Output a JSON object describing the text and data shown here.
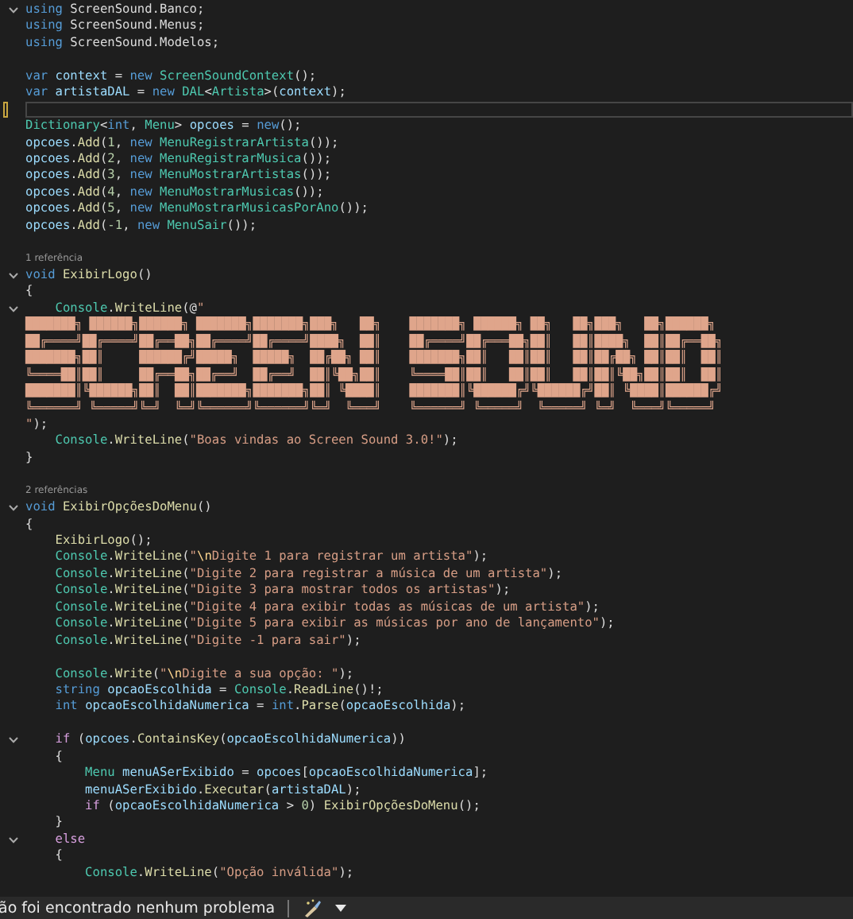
{
  "editor": {
    "lines": [
      {
        "kind": "code",
        "fold": true,
        "tokens": [
          {
            "kind": "keyword",
            "text": "using "
          },
          {
            "kind": "plain",
            "text": "ScreenSound.Banco;"
          }
        ]
      },
      {
        "kind": "code",
        "tokens": [
          {
            "kind": "keyword",
            "text": "using "
          },
          {
            "kind": "plain",
            "text": "ScreenSound.Menus;"
          }
        ]
      },
      {
        "kind": "code",
        "tokens": [
          {
            "kind": "keyword",
            "text": "using "
          },
          {
            "kind": "plain",
            "text": "ScreenSound.Modelos;"
          }
        ]
      },
      {
        "kind": "blank"
      },
      {
        "kind": "code",
        "tokens": [
          {
            "kind": "keyword",
            "text": "var "
          },
          {
            "kind": "variable",
            "text": "context"
          },
          {
            "kind": "plain",
            "text": " = "
          },
          {
            "kind": "keyword",
            "text": "new "
          },
          {
            "kind": "type",
            "text": "ScreenSoundContext"
          },
          {
            "kind": "plain",
            "text": "();"
          }
        ]
      },
      {
        "kind": "code",
        "tokens": [
          {
            "kind": "keyword",
            "text": "var "
          },
          {
            "kind": "variable",
            "text": "artistaDAL"
          },
          {
            "kind": "plain",
            "text": " = "
          },
          {
            "kind": "keyword",
            "text": "new "
          },
          {
            "kind": "type",
            "text": "DAL"
          },
          {
            "kind": "plain",
            "text": "<"
          },
          {
            "kind": "type",
            "text": "Artista"
          },
          {
            "kind": "plain",
            "text": ">("
          },
          {
            "kind": "variable",
            "text": "context"
          },
          {
            "kind": "plain",
            "text": ");"
          }
        ]
      },
      {
        "kind": "blank",
        "current": true
      },
      {
        "kind": "code",
        "tokens": [
          {
            "kind": "type",
            "text": "Dictionary"
          },
          {
            "kind": "plain",
            "text": "<"
          },
          {
            "kind": "keyword",
            "text": "int"
          },
          {
            "kind": "plain",
            "text": ", "
          },
          {
            "kind": "type",
            "text": "Menu"
          },
          {
            "kind": "plain",
            "text": "> "
          },
          {
            "kind": "variable",
            "text": "opcoes"
          },
          {
            "kind": "plain",
            "text": " = "
          },
          {
            "kind": "keyword",
            "text": "new"
          },
          {
            "kind": "plain",
            "text": "();"
          }
        ]
      },
      {
        "kind": "code",
        "tokens": [
          {
            "kind": "variable",
            "text": "opcoes"
          },
          {
            "kind": "plain",
            "text": "."
          },
          {
            "kind": "method",
            "text": "Add"
          },
          {
            "kind": "plain",
            "text": "("
          },
          {
            "kind": "number",
            "text": "1"
          },
          {
            "kind": "plain",
            "text": ", "
          },
          {
            "kind": "keyword",
            "text": "new "
          },
          {
            "kind": "type",
            "text": "MenuRegistrarArtista"
          },
          {
            "kind": "plain",
            "text": "());"
          }
        ]
      },
      {
        "kind": "code",
        "tokens": [
          {
            "kind": "variable",
            "text": "opcoes"
          },
          {
            "kind": "plain",
            "text": "."
          },
          {
            "kind": "method",
            "text": "Add"
          },
          {
            "kind": "plain",
            "text": "("
          },
          {
            "kind": "number",
            "text": "2"
          },
          {
            "kind": "plain",
            "text": ", "
          },
          {
            "kind": "keyword",
            "text": "new "
          },
          {
            "kind": "type",
            "text": "MenuRegistrarMusica"
          },
          {
            "kind": "plain",
            "text": "());"
          }
        ]
      },
      {
        "kind": "code",
        "tokens": [
          {
            "kind": "variable",
            "text": "opcoes"
          },
          {
            "kind": "plain",
            "text": "."
          },
          {
            "kind": "method",
            "text": "Add"
          },
          {
            "kind": "plain",
            "text": "("
          },
          {
            "kind": "number",
            "text": "3"
          },
          {
            "kind": "plain",
            "text": ", "
          },
          {
            "kind": "keyword",
            "text": "new "
          },
          {
            "kind": "type",
            "text": "MenuMostrarArtistas"
          },
          {
            "kind": "plain",
            "text": "());"
          }
        ]
      },
      {
        "kind": "code",
        "tokens": [
          {
            "kind": "variable",
            "text": "opcoes"
          },
          {
            "kind": "plain",
            "text": "."
          },
          {
            "kind": "method",
            "text": "Add"
          },
          {
            "kind": "plain",
            "text": "("
          },
          {
            "kind": "number",
            "text": "4"
          },
          {
            "kind": "plain",
            "text": ", "
          },
          {
            "kind": "keyword",
            "text": "new "
          },
          {
            "kind": "type",
            "text": "MenuMostrarMusicas"
          },
          {
            "kind": "plain",
            "text": "());"
          }
        ]
      },
      {
        "kind": "code",
        "tokens": [
          {
            "kind": "variable",
            "text": "opcoes"
          },
          {
            "kind": "plain",
            "text": "."
          },
          {
            "kind": "method",
            "text": "Add"
          },
          {
            "kind": "plain",
            "text": "("
          },
          {
            "kind": "number",
            "text": "5"
          },
          {
            "kind": "plain",
            "text": ", "
          },
          {
            "kind": "keyword",
            "text": "new "
          },
          {
            "kind": "type",
            "text": "MenuMostrarMusicasPorAno"
          },
          {
            "kind": "plain",
            "text": "());"
          }
        ]
      },
      {
        "kind": "code",
        "tokens": [
          {
            "kind": "variable",
            "text": "opcoes"
          },
          {
            "kind": "plain",
            "text": "."
          },
          {
            "kind": "method",
            "text": "Add"
          },
          {
            "kind": "plain",
            "text": "("
          },
          {
            "kind": "number",
            "text": "-1"
          },
          {
            "kind": "plain",
            "text": ", "
          },
          {
            "kind": "keyword",
            "text": "new "
          },
          {
            "kind": "type",
            "text": "MenuSair"
          },
          {
            "kind": "plain",
            "text": "());"
          }
        ]
      },
      {
        "kind": "blank"
      },
      {
        "kind": "codelens",
        "text": "1 referência"
      },
      {
        "kind": "code",
        "fold": true,
        "tokens": [
          {
            "kind": "keyword",
            "text": "void "
          },
          {
            "kind": "method",
            "text": "ExibirLogo"
          },
          {
            "kind": "plain",
            "text": "()"
          }
        ]
      },
      {
        "kind": "code",
        "tokens": [
          {
            "kind": "plain",
            "text": "{"
          }
        ]
      },
      {
        "kind": "code",
        "fold": true,
        "tokens": [
          {
            "kind": "type",
            "text": "    Console"
          },
          {
            "kind": "plain",
            "text": "."
          },
          {
            "kind": "method",
            "text": "WriteLine"
          },
          {
            "kind": "plain",
            "text": "(@"
          },
          {
            "kind": "string",
            "text": "\""
          }
        ]
      },
      {
        "kind": "art",
        "text": "███████╗ ██████╗██████╗ ███████╗███████╗███╗   ██╗    ███████╗ ██████╗ ██╗   ██╗███╗   ██╗██████╗"
      },
      {
        "kind": "art",
        "text": "██╔════╝██╔════╝██╔══██╗██╔════╝██╔════╝████╗  ██║    ██╔════╝██╔═══██╗██║   ██║████╗  ██║██╔══██╗"
      },
      {
        "kind": "art",
        "text": "███████╗██║     ██████╔╝█████╗  █████╗  ██╔██╗ ██║    ███████╗██║   ██║██║   ██║██╔██╗ ██║██║  ██║"
      },
      {
        "kind": "art",
        "text": "╚════██║██║     ██╔══██╗██╔══╝  ██╔══╝  ██║╚██╗██║    ╚════██║██║   ██║██║   ██║██║╚██╗██║██║  ██║"
      },
      {
        "kind": "art",
        "text": "███████║╚██████╗██║  ██║███████╗███████╗██║ ╚████║    ███████║╚██████╔╝╚██████╔╝██║ ╚████║██████╔╝"
      },
      {
        "kind": "art",
        "text": "╚══════╝ ╚═════╝╚═╝  ╚═╝╚══════╝╚══════╝╚═╝  ╚═══╝    ╚══════╝ ╚═════╝  ╚═════╝ ╚═╝  ╚═══╝╚═════╝"
      },
      {
        "kind": "code",
        "tokens": [
          {
            "kind": "string",
            "text": "\""
          },
          {
            "kind": "plain",
            "text": ");"
          }
        ]
      },
      {
        "kind": "code",
        "tokens": [
          {
            "kind": "type",
            "text": "    Console"
          },
          {
            "kind": "plain",
            "text": "."
          },
          {
            "kind": "method",
            "text": "WriteLine"
          },
          {
            "kind": "plain",
            "text": "("
          },
          {
            "kind": "string",
            "text": "\"Boas vindas ao Screen Sound 3.0!\""
          },
          {
            "kind": "plain",
            "text": ");"
          }
        ]
      },
      {
        "kind": "code",
        "tokens": [
          {
            "kind": "plain",
            "text": "}"
          }
        ]
      },
      {
        "kind": "blank"
      },
      {
        "kind": "codelens",
        "text": "2 referências"
      },
      {
        "kind": "code",
        "fold": true,
        "tokens": [
          {
            "kind": "keyword",
            "text": "void "
          },
          {
            "kind": "method",
            "text": "ExibirOpçõesDoMenu"
          },
          {
            "kind": "plain",
            "text": "()"
          }
        ]
      },
      {
        "kind": "code",
        "tokens": [
          {
            "kind": "plain",
            "text": "{"
          }
        ]
      },
      {
        "kind": "code",
        "tokens": [
          {
            "kind": "method",
            "text": "    ExibirLogo"
          },
          {
            "kind": "plain",
            "text": "();"
          }
        ]
      },
      {
        "kind": "code",
        "tokens": [
          {
            "kind": "type",
            "text": "    Console"
          },
          {
            "kind": "plain",
            "text": "."
          },
          {
            "kind": "method",
            "text": "WriteLine"
          },
          {
            "kind": "plain",
            "text": "("
          },
          {
            "kind": "string",
            "text": "\""
          },
          {
            "kind": "escape",
            "text": "\\n"
          },
          {
            "kind": "string",
            "text": "Digite 1 para registrar um artista\""
          },
          {
            "kind": "plain",
            "text": ");"
          }
        ]
      },
      {
        "kind": "code",
        "tokens": [
          {
            "kind": "type",
            "text": "    Console"
          },
          {
            "kind": "plain",
            "text": "."
          },
          {
            "kind": "method",
            "text": "WriteLine"
          },
          {
            "kind": "plain",
            "text": "("
          },
          {
            "kind": "string",
            "text": "\"Digite 2 para registrar a música de um artista\""
          },
          {
            "kind": "plain",
            "text": ");"
          }
        ]
      },
      {
        "kind": "code",
        "tokens": [
          {
            "kind": "type",
            "text": "    Console"
          },
          {
            "kind": "plain",
            "text": "."
          },
          {
            "kind": "method",
            "text": "WriteLine"
          },
          {
            "kind": "plain",
            "text": "("
          },
          {
            "kind": "string",
            "text": "\"Digite 3 para mostrar todos os artistas\""
          },
          {
            "kind": "plain",
            "text": ");"
          }
        ]
      },
      {
        "kind": "code",
        "tokens": [
          {
            "kind": "type",
            "text": "    Console"
          },
          {
            "kind": "plain",
            "text": "."
          },
          {
            "kind": "method",
            "text": "WriteLine"
          },
          {
            "kind": "plain",
            "text": "("
          },
          {
            "kind": "string",
            "text": "\"Digite 4 para exibir todas as músicas de um artista\""
          },
          {
            "kind": "plain",
            "text": ");"
          }
        ]
      },
      {
        "kind": "code",
        "tokens": [
          {
            "kind": "type",
            "text": "    Console"
          },
          {
            "kind": "plain",
            "text": "."
          },
          {
            "kind": "method",
            "text": "WriteLine"
          },
          {
            "kind": "plain",
            "text": "("
          },
          {
            "kind": "string",
            "text": "\"Digite 5 para exibir as músicas por ano de lançamento\""
          },
          {
            "kind": "plain",
            "text": ");"
          }
        ]
      },
      {
        "kind": "code",
        "tokens": [
          {
            "kind": "type",
            "text": "    Console"
          },
          {
            "kind": "plain",
            "text": "."
          },
          {
            "kind": "method",
            "text": "WriteLine"
          },
          {
            "kind": "plain",
            "text": "("
          },
          {
            "kind": "string",
            "text": "\"Digite -1 para sair\""
          },
          {
            "kind": "plain",
            "text": ");"
          }
        ]
      },
      {
        "kind": "blank"
      },
      {
        "kind": "code",
        "tokens": [
          {
            "kind": "type",
            "text": "    Console"
          },
          {
            "kind": "plain",
            "text": "."
          },
          {
            "kind": "method",
            "text": "Write"
          },
          {
            "kind": "plain",
            "text": "("
          },
          {
            "kind": "string",
            "text": "\""
          },
          {
            "kind": "escape",
            "text": "\\n"
          },
          {
            "kind": "string",
            "text": "Digite a sua opção: \""
          },
          {
            "kind": "plain",
            "text": ");"
          }
        ]
      },
      {
        "kind": "code",
        "tokens": [
          {
            "kind": "keyword",
            "text": "    string "
          },
          {
            "kind": "variable",
            "text": "opcaoEscolhida"
          },
          {
            "kind": "plain",
            "text": " = "
          },
          {
            "kind": "type",
            "text": "Console"
          },
          {
            "kind": "plain",
            "text": "."
          },
          {
            "kind": "method",
            "text": "ReadLine"
          },
          {
            "kind": "plain",
            "text": "()!;"
          }
        ]
      },
      {
        "kind": "code",
        "tokens": [
          {
            "kind": "keyword",
            "text": "    int "
          },
          {
            "kind": "variable",
            "text": "opcaoEscolhidaNumerica"
          },
          {
            "kind": "plain",
            "text": " = "
          },
          {
            "kind": "keyword",
            "text": "int"
          },
          {
            "kind": "plain",
            "text": "."
          },
          {
            "kind": "method",
            "text": "Parse"
          },
          {
            "kind": "plain",
            "text": "("
          },
          {
            "kind": "variable",
            "text": "opcaoEscolhida"
          },
          {
            "kind": "plain",
            "text": ");"
          }
        ]
      },
      {
        "kind": "blank"
      },
      {
        "kind": "code",
        "fold": true,
        "tokens": [
          {
            "kind": "control",
            "text": "    if"
          },
          {
            "kind": "plain",
            "text": " ("
          },
          {
            "kind": "variable",
            "text": "opcoes"
          },
          {
            "kind": "plain",
            "text": "."
          },
          {
            "kind": "method",
            "text": "ContainsKey"
          },
          {
            "kind": "plain",
            "text": "("
          },
          {
            "kind": "variable",
            "text": "opcaoEscolhidaNumerica"
          },
          {
            "kind": "plain",
            "text": "))"
          }
        ]
      },
      {
        "kind": "code",
        "tokens": [
          {
            "kind": "plain",
            "text": "    {"
          }
        ]
      },
      {
        "kind": "code",
        "tokens": [
          {
            "kind": "type",
            "text": "        Menu "
          },
          {
            "kind": "variable",
            "text": "menuASerExibido"
          },
          {
            "kind": "plain",
            "text": " = "
          },
          {
            "kind": "variable",
            "text": "opcoes"
          },
          {
            "kind": "plain",
            "text": "["
          },
          {
            "kind": "variable",
            "text": "opcaoEscolhidaNumerica"
          },
          {
            "kind": "plain",
            "text": "];"
          }
        ]
      },
      {
        "kind": "code",
        "tokens": [
          {
            "kind": "variable",
            "text": "        menuASerExibido"
          },
          {
            "kind": "plain",
            "text": "."
          },
          {
            "kind": "method",
            "text": "Executar"
          },
          {
            "kind": "plain",
            "text": "("
          },
          {
            "kind": "variable",
            "text": "artistaDAL"
          },
          {
            "kind": "plain",
            "text": ");"
          }
        ]
      },
      {
        "kind": "code",
        "tokens": [
          {
            "kind": "control",
            "text": "        if"
          },
          {
            "kind": "plain",
            "text": " ("
          },
          {
            "kind": "variable",
            "text": "opcaoEscolhidaNumerica"
          },
          {
            "kind": "plain",
            "text": " > "
          },
          {
            "kind": "number",
            "text": "0"
          },
          {
            "kind": "plain",
            "text": ") "
          },
          {
            "kind": "method",
            "text": "ExibirOpçõesDoMenu"
          },
          {
            "kind": "plain",
            "text": "();"
          }
        ]
      },
      {
        "kind": "code",
        "tokens": [
          {
            "kind": "plain",
            "text": "    }"
          }
        ]
      },
      {
        "kind": "code",
        "fold": true,
        "tokens": [
          {
            "kind": "control",
            "text": "    else"
          }
        ]
      },
      {
        "kind": "code",
        "tokens": [
          {
            "kind": "plain",
            "text": "    {"
          }
        ]
      },
      {
        "kind": "code",
        "tokens": [
          {
            "kind": "type",
            "text": "        Console"
          },
          {
            "kind": "plain",
            "text": "."
          },
          {
            "kind": "method",
            "text": "WriteLine"
          },
          {
            "kind": "plain",
            "text": "("
          },
          {
            "kind": "string",
            "text": "\"Opção inválida\""
          },
          {
            "kind": "plain",
            "text": ");"
          }
        ]
      }
    ]
  },
  "status_bar": {
    "message": "ão foi encontrado nenhum problema"
  }
}
